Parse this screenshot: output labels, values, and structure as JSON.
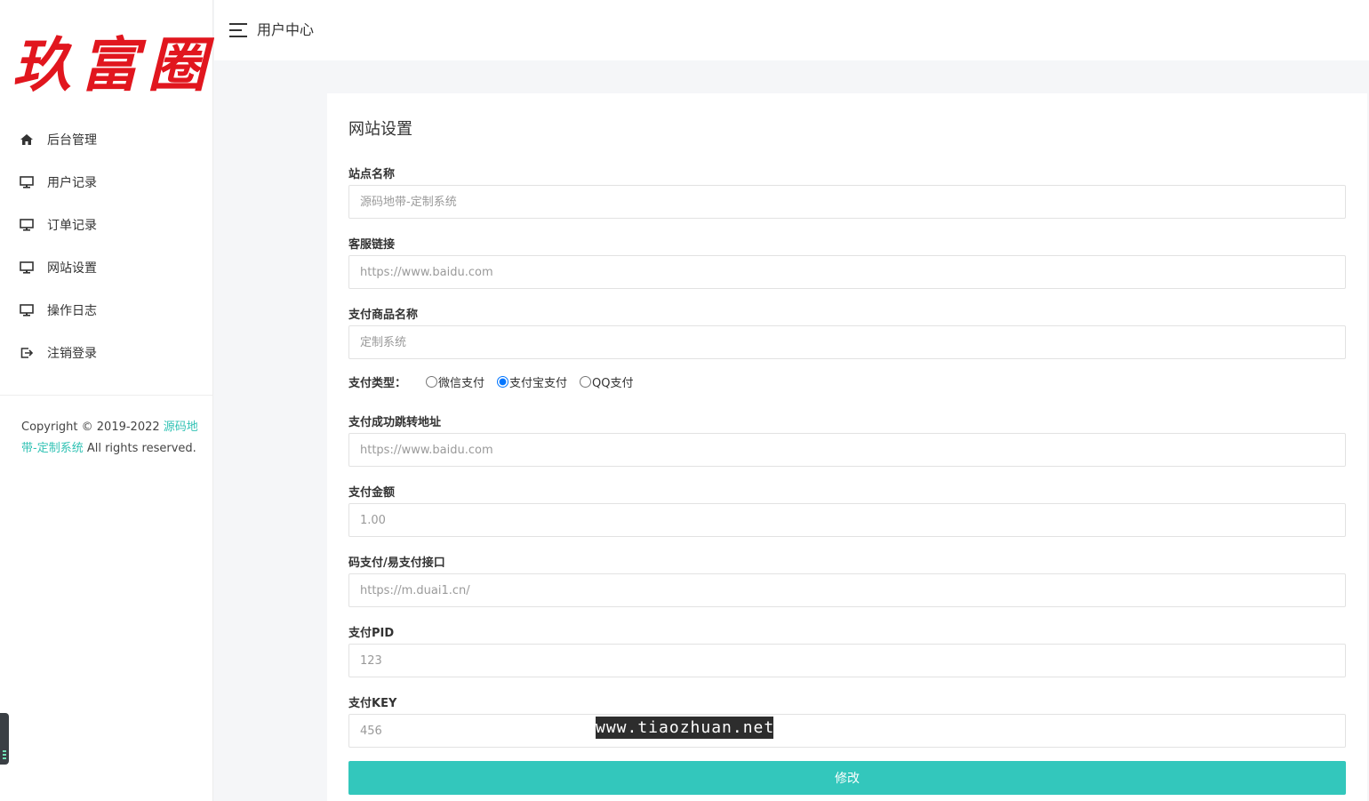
{
  "brand": {
    "logo_text": "玖富圈",
    "logo_color": "#e1161e"
  },
  "sidebar": {
    "items": [
      {
        "label": "后台管理",
        "icon": "home-icon"
      },
      {
        "label": "用户记录",
        "icon": "monitor-icon"
      },
      {
        "label": "订单记录",
        "icon": "monitor-icon"
      },
      {
        "label": "网站设置",
        "icon": "monitor-icon"
      },
      {
        "label": "操作日志",
        "icon": "monitor-icon"
      },
      {
        "label": "注销登录",
        "icon": "logout-icon"
      }
    ],
    "copyright": {
      "prefix": "Copyright © 2019-2022 ",
      "link": "源码地带-定制系统",
      "suffix": " All rights reserved."
    }
  },
  "header": {
    "menu_icon": "hamburger-icon",
    "title": "用户中心"
  },
  "form": {
    "title": "网站设置",
    "fields": [
      {
        "label": "站点名称",
        "placeholder": "源码地带-定制系统"
      },
      {
        "label": "客服链接",
        "placeholder": "https://www.baidu.com"
      },
      {
        "label": "支付商品名称",
        "placeholder": "定制系统"
      },
      {
        "label": "支付成功跳转地址",
        "placeholder": "https://www.baidu.com"
      },
      {
        "label": "支付金额",
        "placeholder": "1.00"
      },
      {
        "label": "码支付/易支付接口",
        "placeholder": "https://m.duai1.cn/"
      },
      {
        "label": "支付PID",
        "placeholder": "123"
      },
      {
        "label": "支付KEY",
        "placeholder": "456"
      }
    ],
    "pay_type": {
      "label": "支付类型：",
      "options": [
        "微信支付",
        "支付宝支付",
        "QQ支付"
      ],
      "selected": "支付宝支付"
    },
    "submit_label": "修改",
    "accent_color": "#33c7bc"
  },
  "watermark": "www.tiaozhuan.net"
}
